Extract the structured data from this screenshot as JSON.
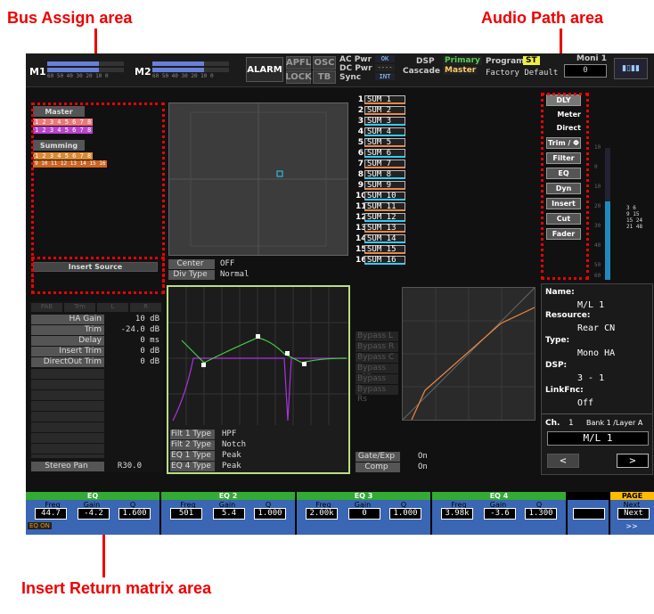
{
  "annotations": {
    "bus_assign": "Bus Assign area",
    "audio_path": "Audio Path area",
    "insert_return": "Insert Return matrix area"
  },
  "top_bar": {
    "m1": "M1",
    "m2": "M2",
    "meter_scale": "60 50 40 30 20 10 0",
    "alarm": "ALARM",
    "apfl": "APFL",
    "osc": "OSC",
    "lock": "LOCK",
    "tb": "TB",
    "ac_pwr": "AC Pwr",
    "dc_pwr": "DC Pwr",
    "sync": "Sync",
    "ac_state": "OK",
    "dc_state": "----",
    "sync_state": "INT",
    "dsp": "DSP",
    "cascade": "Cascade",
    "primary": "Primary",
    "master": "Master",
    "program": "Program",
    "program_st": "ST",
    "program_name": "Factory Default",
    "moni": "Moni 1",
    "moni_val": "0"
  },
  "bus_assign": {
    "master_label": "Master",
    "master_row1": "1 2 3 4 5 6 7 8",
    "master_row2": "1 2 3 4 5 6 7 8",
    "summing_label": "Summing",
    "summing_row1": "1 2 3 4 5 6 7 8",
    "summing_row2": "9 10 11 12 13 14 15 16",
    "insert_source": "Insert Source"
  },
  "panner": {
    "center_label": "Center",
    "center_val": "OFF",
    "div_type_label": "Div Type",
    "div_type_val": "Normal"
  },
  "channel_params": {
    "tabs": [
      "PAB",
      "Trm",
      "L",
      "R"
    ],
    "rows": [
      {
        "label": "HA Gain",
        "value": "10 dB"
      },
      {
        "label": "Trim",
        "value": "-24.0 dB"
      },
      {
        "label": "Delay",
        "value": "0 ms"
      },
      {
        "label": "Insert Trim",
        "value": "0 dB"
      },
      {
        "label": "DirectOut Trim",
        "value": "0 dB"
      }
    ],
    "stereo_pan_label": "Stereo Pan",
    "stereo_pan_val": "R30.0"
  },
  "eq_types": [
    {
      "label": "Filt 1 Type",
      "value": "HPF"
    },
    {
      "label": "Filt 2 Type",
      "value": "Notch"
    },
    {
      "label": "EQ 1 Type",
      "value": "Peak"
    },
    {
      "label": "EQ 4 Type",
      "value": "Peak"
    }
  ],
  "sums": [
    "SUM 1",
    "SUM 2",
    "SUM 3",
    "SUM 4",
    "SUM 5",
    "SUM 6",
    "SUM 7",
    "SUM 8",
    "SUM 9",
    "SUM 10",
    "SUM 11",
    "SUM 12",
    "SUM 13",
    "SUM 14",
    "SUM 15",
    "SUM 16"
  ],
  "sum_nums": [
    "1",
    "2",
    "3",
    "4",
    "5",
    "6",
    "7",
    "8",
    "9",
    "10",
    "11",
    "12",
    "13",
    "14",
    "15",
    "16"
  ],
  "bypass": [
    "Bypass L",
    "Bypass R",
    "Bypass C",
    "Bypass LFE",
    "Bypass Ls",
    "Bypass Rs"
  ],
  "dynamics": [
    {
      "label": "Gate/Exp",
      "value": "On"
    },
    {
      "label": "Comp",
      "value": "On"
    }
  ],
  "audio_path": [
    "DLY",
    "Meter",
    "Direct",
    "Trim / Φ",
    "Filter",
    "EQ",
    "Dyn",
    "Insert",
    "Cut",
    "Fader"
  ],
  "meter_scale": [
    "10",
    "0",
    "10",
    "20",
    "30",
    "40",
    "50",
    "60"
  ],
  "meter_ch_labels": "3 6\n9 15\n15 24\n21 48",
  "info": {
    "name_label": "Name:",
    "name_val": "M/L 1",
    "resource_label": "Resource:",
    "resource_val": "Rear CN",
    "type_label": "Type:",
    "type_val": "Mono HA",
    "dsp_label": "DSP:",
    "dsp_val": "3 - 1",
    "linkfnc_label": "LinkFnc:",
    "linkfnc_val": "Off",
    "ch_label": "Ch.",
    "ch_num": "1",
    "bank_layer": "Bank 1 /Layer A",
    "ch_name": "M/L 1",
    "prev": "<",
    "next": ">"
  },
  "bottom_bar": {
    "sections": [
      {
        "title": "EQ",
        "freq": "44.7",
        "gain": "-4.2",
        "q": "1.600",
        "extra": "EQ ON"
      },
      {
        "title": "EQ 2",
        "freq": "501",
        "gain": "5.4",
        "q": "1.000"
      },
      {
        "title": "EQ 3",
        "freq": "2.00k",
        "gain": "0",
        "q": "1.000"
      },
      {
        "title": "EQ 4",
        "freq": "3.98k",
        "gain": "-3.6",
        "q": "1.300"
      }
    ],
    "freq_label": "Freq",
    "gain_label": "Gain",
    "q_label": "Q",
    "page_label": "PAGE",
    "next_label": "Next",
    "next_val": "Next",
    "arrows": ">>"
  }
}
